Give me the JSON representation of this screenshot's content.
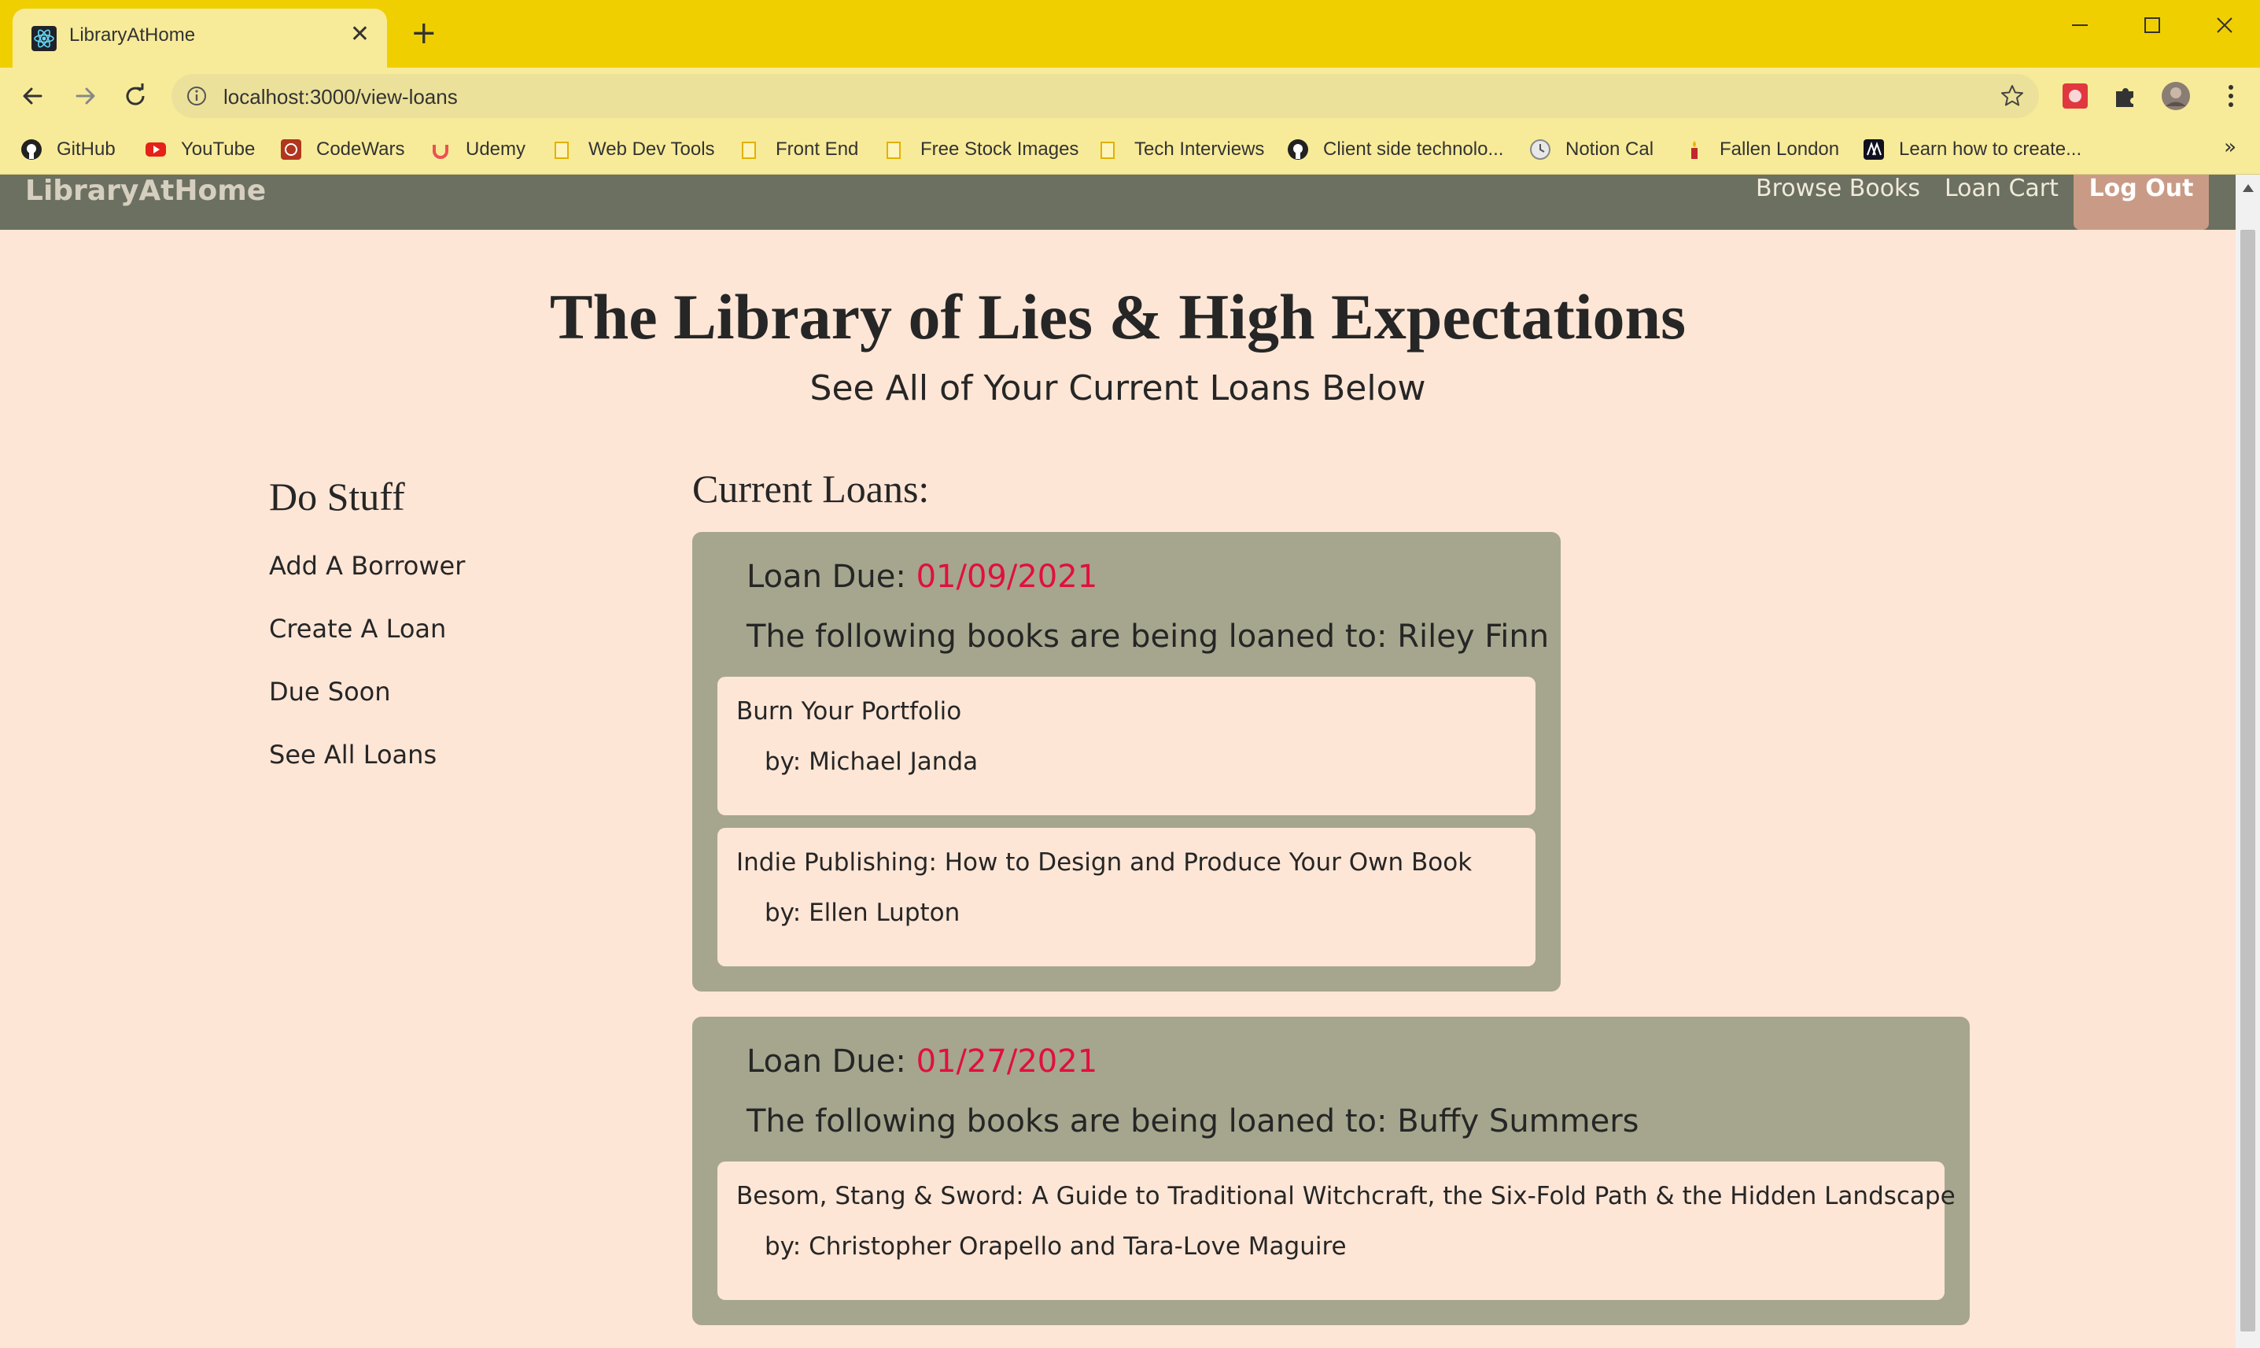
{
  "browser": {
    "tab_title": "LibraryAtHome",
    "url": "localhost:3000/view-loans",
    "bookmarks": [
      {
        "label": "GitHub",
        "icon": "github-icon"
      },
      {
        "label": "YouTube",
        "icon": "youtube-icon"
      },
      {
        "label": "CodeWars",
        "icon": "codewars-icon"
      },
      {
        "label": "Udemy",
        "icon": "udemy-icon"
      },
      {
        "label": "Web Dev Tools",
        "icon": "folder-icon"
      },
      {
        "label": "Front End",
        "icon": "folder-icon"
      },
      {
        "label": "Free Stock Images",
        "icon": "folder-icon"
      },
      {
        "label": "Tech Interviews",
        "icon": "folder-icon"
      },
      {
        "label": "Client side technolo...",
        "icon": "github-icon"
      },
      {
        "label": "Notion Cal",
        "icon": "clock-icon"
      },
      {
        "label": "Fallen London",
        "icon": "candle-icon"
      },
      {
        "label": "Learn how to create...",
        "icon": "aa-icon"
      }
    ],
    "bookmarks_overflow": "»"
  },
  "navbar": {
    "brand": "LibraryAtHome",
    "links": [
      "Browse Books",
      "Loan Cart"
    ],
    "logout": "Log Out"
  },
  "header": {
    "title": "The Library of Lies & High Expectations",
    "subtitle": "See All of Your Current Loans Below"
  },
  "sidebar": {
    "title": "Do Stuff",
    "links": [
      "Add A Borrower",
      "Create A Loan",
      "Due Soon",
      "See All Loans"
    ]
  },
  "loans": {
    "heading": "Current Loans:",
    "due_label": "Loan Due: ",
    "to_label": "The following books are being loaned to: ",
    "items": [
      {
        "due": "01/09/2021",
        "borrower": "Riley Finn",
        "books": [
          {
            "title": "Burn Your Portfolio",
            "author": "by: Michael Janda"
          },
          {
            "title": "Indie Publishing: How to Design and Produce Your Own Book",
            "author": "by: Ellen Lupton"
          }
        ]
      },
      {
        "due": "01/27/2021",
        "borrower": "Buffy Summers",
        "books": [
          {
            "title": "Besom, Stang & Sword: A Guide to Traditional Witchcraft, the Six-Fold Path & the Hidden Landscape",
            "author": "by: Christopher Orapello and Tara-Love Maguire"
          }
        ]
      }
    ]
  },
  "colors": {
    "navbar": "#6b7060",
    "page_bg": "#fee6d6",
    "loan_card": "#a5a68d",
    "due_date": "#e0103d",
    "logout_button": "#c99b87",
    "browser_frame": "#f0cf00"
  }
}
